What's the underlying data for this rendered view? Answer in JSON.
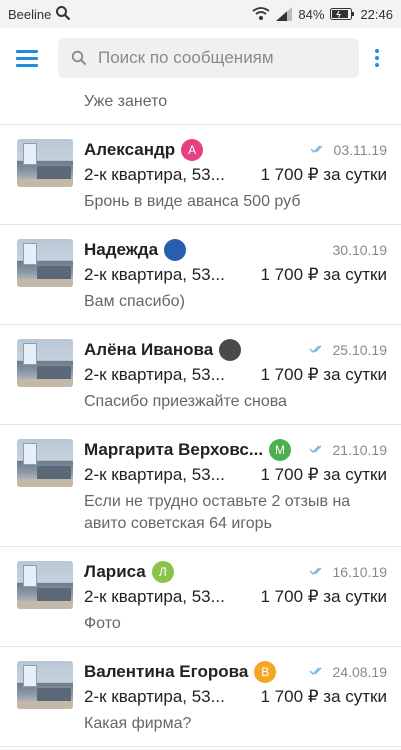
{
  "status_bar": {
    "carrier": "Beeline",
    "battery": "84%",
    "time": "22:46"
  },
  "search": {
    "placeholder": "Поиск по сообщениям"
  },
  "previous_item": {
    "message": "Уже зането"
  },
  "conversations": [
    {
      "name": "Александр",
      "avatar_letter": "А",
      "avatar_color": "#e63f84",
      "read_ticks": true,
      "date": "03.11.19",
      "listing_title": "2-к квартира, 53...",
      "price": "1 700 ₽ за сутки",
      "message": "Бронь в виде аванса 500 руб"
    },
    {
      "name": "Надежда",
      "avatar_letter": "",
      "avatar_color": "#2a5db0",
      "read_ticks": false,
      "date": "30.10.19",
      "listing_title": "2-к квартира, 53...",
      "price": "1 700 ₽ за сутки",
      "message": "Вам спасибо)"
    },
    {
      "name": "Алёна Иванова",
      "avatar_letter": "",
      "avatar_color": "#4a4a4a",
      "read_ticks": true,
      "date": "25.10.19",
      "listing_title": "2-к квартира, 53...",
      "price": "1 700 ₽ за сутки",
      "message": "Спасибо приезжайте снова"
    },
    {
      "name": "Маргарита Верховс...",
      "avatar_letter": "М",
      "avatar_color": "#4caf50",
      "read_ticks": true,
      "date": "21.10.19",
      "listing_title": "2-к квартира, 53...",
      "price": "1 700 ₽ за сутки",
      "message": "Если не трудно оставьте 2 отзыв на авито советская 64 игорь"
    },
    {
      "name": "Лариса",
      "avatar_letter": "Л",
      "avatar_color": "#8bc34a",
      "read_ticks": true,
      "date": "16.10.19",
      "listing_title": "2-к квартира, 53...",
      "price": "1 700 ₽ за сутки",
      "message": "Фото"
    },
    {
      "name": "Валентина Егорова",
      "avatar_letter": "В",
      "avatar_color": "#f5a623",
      "read_ticks": true,
      "date": "24.08.19",
      "listing_title": "2-к квартира, 53...",
      "price": "1 700 ₽ за сутки",
      "message": "Какая фирма?"
    }
  ],
  "colors": {
    "accent": "#1f8ee0",
    "tick": "#79b6e3"
  },
  "icons": {
    "status_search": "search-icon",
    "wifi": "wifi-icon",
    "signal": "signal-icon",
    "battery": "battery-icon",
    "menu": "hamburger-menu-icon",
    "search": "search-icon",
    "more": "more-vertical-icon",
    "read": "double-check-icon"
  }
}
